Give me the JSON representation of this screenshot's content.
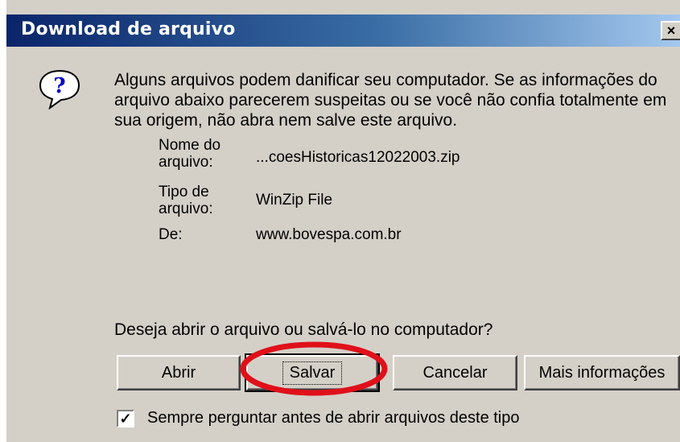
{
  "dialog": {
    "title": "Download de arquivo",
    "close_glyph": "×",
    "icon": "question-icon",
    "warning_text": "Alguns arquivos podem danificar seu computador. Se as informações do arquivo abaixo parecerem suspeitas ou se você não confia totalmente em sua origem, não abra nem salve este arquivo.",
    "file_info": [
      {
        "label": "Nome do arquivo:",
        "value": "...coesHistoricas12022003.zip"
      },
      {
        "label": "Tipo de arquivo:",
        "value": "WinZip File"
      },
      {
        "label": "De:",
        "value": "www.bovespa.com.br"
      }
    ],
    "question": "Deseja abrir o arquivo ou salvá-lo no computador?",
    "buttons": {
      "open": "Abrir",
      "save": "Salvar",
      "cancel": "Cancelar",
      "more_info": "Mais informações"
    },
    "checkbox": {
      "checked": true,
      "mark": "✓",
      "label": "Sempre perguntar antes de abrir arquivos deste tipo"
    },
    "highlight_color": "#e0101a"
  }
}
